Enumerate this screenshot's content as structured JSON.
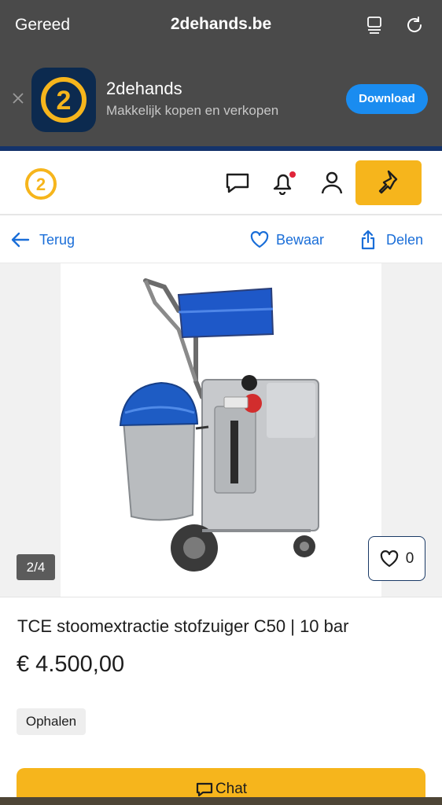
{
  "browser": {
    "done_label": "Gereed",
    "url": "2dehands.be",
    "icons": [
      "reader-icon",
      "reload-icon"
    ]
  },
  "app_banner": {
    "app_name": "2dehands",
    "tagline": "Makkelijk kopen en verkopen",
    "download_label": "Download",
    "logo_text": "2",
    "colors": {
      "background": "#4a4a4a",
      "button": "#1a8cf0",
      "icon_bg": "#0c2a4f",
      "icon_ring": "#f6b51c"
    }
  },
  "header": {
    "logo_text": "2",
    "icons": [
      "chat-icon",
      "bell-icon",
      "user-icon",
      "pin-icon"
    ],
    "notification_dot_color": "#e0243a",
    "accent": "#f6b51c"
  },
  "actions": {
    "back_label": "Terug",
    "save_label": "Bewaar",
    "share_label": "Delen",
    "link_color": "#1a6ed8"
  },
  "gallery": {
    "counter": "2/4",
    "favorite_count": "0"
  },
  "listing": {
    "title": "TCE stoomextractie stofzuiger C50 | 10 bar",
    "price": "€ 4.500,00",
    "delivery_badge": "Ophalen"
  },
  "cta": {
    "chat_label": "Chat"
  }
}
